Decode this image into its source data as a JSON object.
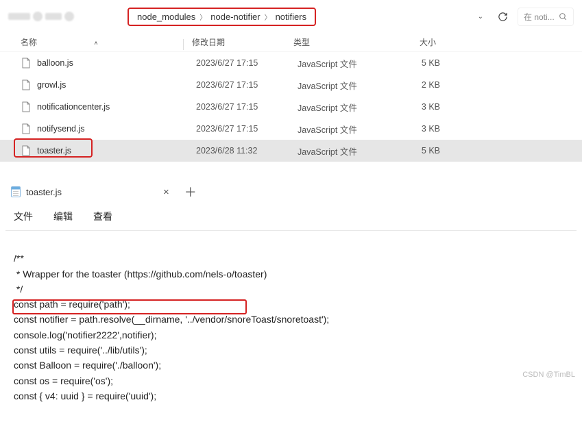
{
  "breadcrumb": {
    "seg1": "node_modules",
    "seg2": "node-notifier",
    "seg3": "notifiers"
  },
  "search": {
    "placeholder": "在 noti..."
  },
  "columns": {
    "name": "名称",
    "date": "修改日期",
    "type": "类型",
    "size": "大小"
  },
  "files": [
    {
      "name": "balloon.js",
      "date": "2023/6/27 17:15",
      "type": "JavaScript 文件",
      "size": "5 KB"
    },
    {
      "name": "growl.js",
      "date": "2023/6/27 17:15",
      "type": "JavaScript 文件",
      "size": "2 KB"
    },
    {
      "name": "notificationcenter.js",
      "date": "2023/6/27 17:15",
      "type": "JavaScript 文件",
      "size": "3 KB"
    },
    {
      "name": "notifysend.js",
      "date": "2023/6/27 17:15",
      "type": "JavaScript 文件",
      "size": "3 KB"
    },
    {
      "name": "toaster.js",
      "date": "2023/6/28 11:32",
      "type": "JavaScript 文件",
      "size": "5 KB"
    }
  ],
  "editor": {
    "tab_name": "toaster.js",
    "menu": {
      "file": "文件",
      "edit": "编辑",
      "view": "查看"
    },
    "code_lines": [
      "/**",
      " * Wrapper for the toaster (https://github.com/nels-o/toaster)",
      " */",
      "const path = require('path');",
      "const notifier = path.resolve(__dirname, '../vendor/snoreToast/snoretoast');",
      "console.log('notifier2222',notifier);",
      "const utils = require('../lib/utils');",
      "const Balloon = require('./balloon');",
      "const os = require('os');",
      "const { v4: uuid } = require('uuid');"
    ]
  },
  "watermark": "CSDN @TimBL"
}
